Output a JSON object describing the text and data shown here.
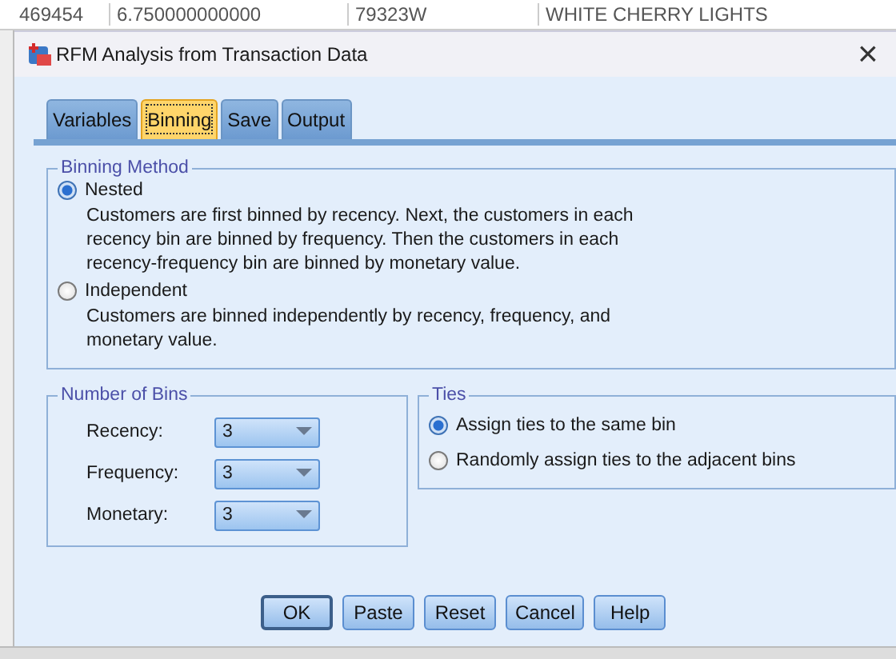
{
  "background_row": {
    "cells": [
      "469454",
      "6.750000000000",
      "79323W",
      "WHITE CHERRY LIGHTS"
    ]
  },
  "window": {
    "title": "RFM Analysis from Transaction Data",
    "close": "×"
  },
  "tabs": [
    {
      "label": "Variables",
      "selected": false
    },
    {
      "label": "Binning",
      "selected": true
    },
    {
      "label": "Save",
      "selected": false
    },
    {
      "label": "Output",
      "selected": false
    }
  ],
  "binning_method": {
    "title": "Binning Method",
    "options": [
      {
        "label": "Nested",
        "selected": true,
        "description": "Customers are first binned by recency. Next, the customers in each recency bin are binned by frequency. Then the customers in each recency-frequency bin are binned by monetary value."
      },
      {
        "label": "Independent",
        "selected": false,
        "description": "Customers are binned independently by recency, frequency, and monetary value."
      }
    ]
  },
  "number_of_bins": {
    "title": "Number of Bins",
    "fields": [
      {
        "label": "Recency:",
        "value": "3"
      },
      {
        "label": "Frequency:",
        "value": "3"
      },
      {
        "label": "Monetary:",
        "value": "3"
      }
    ]
  },
  "ties": {
    "title": "Ties",
    "options": [
      {
        "label": "Assign ties to the same bin",
        "selected": true
      },
      {
        "label": "Randomly assign ties to the adjacent bins",
        "selected": false
      }
    ]
  },
  "buttons": [
    {
      "label": "OK",
      "default": true
    },
    {
      "label": "Paste",
      "default": false
    },
    {
      "label": "Reset",
      "default": false
    },
    {
      "label": "Cancel",
      "default": false
    },
    {
      "label": "Help",
      "default": false
    }
  ]
}
